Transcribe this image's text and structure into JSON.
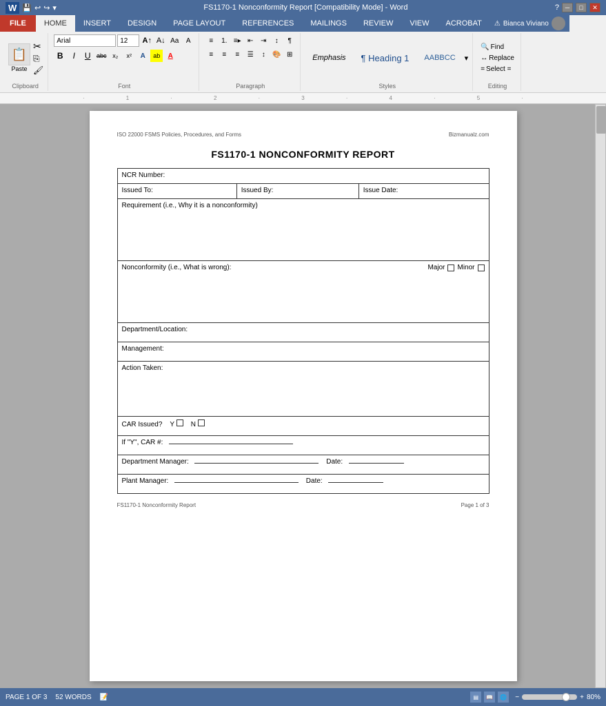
{
  "titleBar": {
    "title": "FS1170-1 Nonconformity Report [Compatibility Mode] - Word",
    "leftIcons": [
      "word-icon",
      "save-icon",
      "undo-icon",
      "redo-icon",
      "quick-icon"
    ],
    "rightIcons": [
      "help-icon",
      "minimize-btn",
      "maximize-btn",
      "close-btn"
    ]
  },
  "ribbon": {
    "tabs": [
      {
        "id": "file",
        "label": "FILE",
        "active": false,
        "file": true
      },
      {
        "id": "home",
        "label": "HOME",
        "active": true
      },
      {
        "id": "insert",
        "label": "INSERT",
        "active": false
      },
      {
        "id": "design",
        "label": "DESIGN",
        "active": false
      },
      {
        "id": "pageLayout",
        "label": "PAGE LAYOUT",
        "active": false
      },
      {
        "id": "references",
        "label": "REFERENCES",
        "active": false
      },
      {
        "id": "mailings",
        "label": "MAILINGS",
        "active": false
      },
      {
        "id": "review",
        "label": "REVIEW",
        "active": false
      },
      {
        "id": "view",
        "label": "VIEW",
        "active": false
      },
      {
        "id": "acrobat",
        "label": "ACROBAT",
        "active": false
      }
    ],
    "groups": {
      "clipboard": {
        "label": "Clipboard",
        "pasteLabel": "Paste"
      },
      "font": {
        "label": "Font",
        "fontName": "Arial",
        "fontSize": "12",
        "bold": "B",
        "italic": "I",
        "underline": "U",
        "strikethrough": "abc",
        "subscript": "x₂",
        "superscript": "x²"
      },
      "paragraph": {
        "label": "Paragraph"
      },
      "styles": {
        "label": "Styles",
        "items": [
          {
            "name": "Emphasis",
            "style": "emphasis"
          },
          {
            "name": "¶ Heading 1",
            "style": "h1"
          },
          {
            "name": "AABBCC",
            "style": "h2"
          }
        ]
      },
      "editing": {
        "label": "Editing",
        "find": "Find",
        "replace": "Replace",
        "select": "Select ="
      }
    },
    "user": {
      "warning": "⚠",
      "name": "Bianca Viviano"
    }
  },
  "document": {
    "header": {
      "left": "ISO 22000 FSMS Policies, Procedures, and Forms",
      "right": "Bizmanualz.com"
    },
    "title": "FS1170-1 NONCONFORMITY REPORT",
    "table": {
      "ncrLabel": "NCR Number:",
      "issuedTo": "Issued To:",
      "issuedBy": "Issued By:",
      "issueDate": "Issue Date:",
      "requirementLabel": "Requirement (i.e., Why it is a nonconformity)",
      "nonconformityLabel": "Nonconformity (i.e., What is wrong):",
      "majorLabel": "Major",
      "minorLabel": "Minor",
      "departmentLabel": "Department/Location:",
      "managementLabel": "Management:",
      "actionTakenLabel": "Action Taken:",
      "carIssuedLabel": "CAR Issued?",
      "carYLabel": "Y",
      "carNLabel": "N",
      "carNumberLabel": "If \"Y\", CAR #:",
      "carNumberLine": "_____________________",
      "deptManagerLabel": "Department Manager:",
      "deptManagerLine": "___________________________________________",
      "deptDateLabel": "Date:",
      "deptDateLine": "__________",
      "plantManagerLabel": "Plant Manager:",
      "plantManagerLine": "___________________________________________",
      "plantDateLabel": "Date:",
      "plantDateLine": "__________"
    },
    "footer": {
      "left": "FS1170-1 Nonconformity Report",
      "right": "Page 1 of 3"
    }
  },
  "statusBar": {
    "pageInfo": "PAGE 1 OF 3",
    "wordCount": "52 WORDS",
    "viewIcons": [
      "print-layout-icon",
      "read-mode-icon",
      "web-layout-icon"
    ],
    "zoomPercent": "80%"
  }
}
